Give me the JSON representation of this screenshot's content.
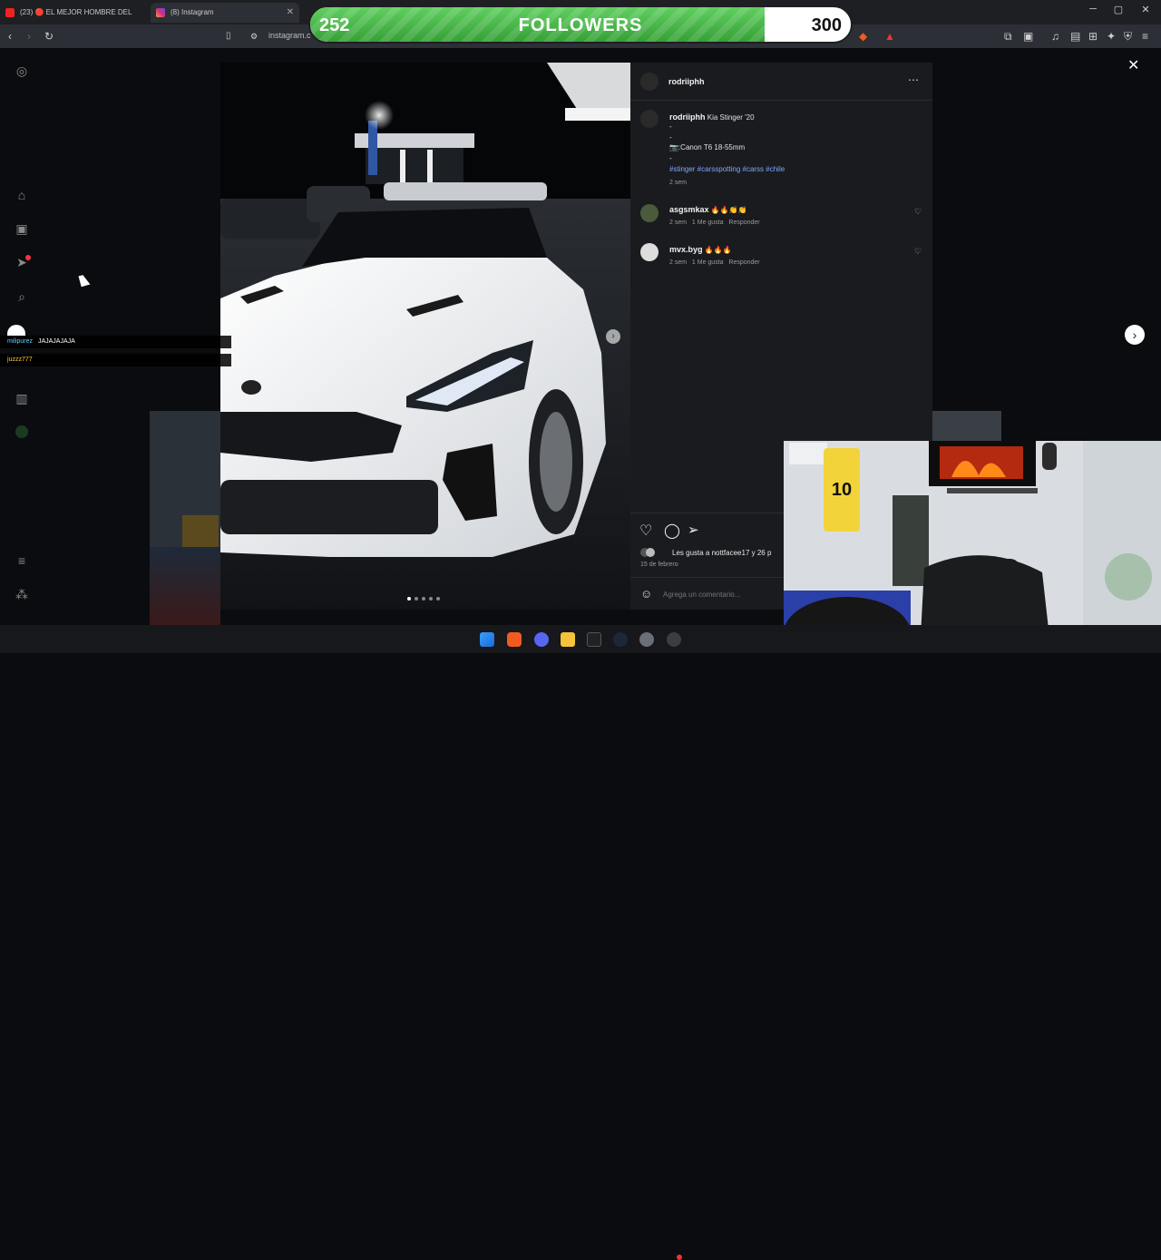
{
  "browser": {
    "tabs": [
      {
        "label": "(23) 🔴 EL MEJOR HOMBRE DEL"
      },
      {
        "label": "(8) Instagram"
      }
    ],
    "url": "instagram.c"
  },
  "followers_overlay": {
    "current": "252",
    "label": "FOLLOWERS",
    "goal": "300",
    "progress": 0.84
  },
  "chat_overlay": {
    "rows": [
      {
        "user": "milipurez",
        "msg": "JAJAJAJAJA"
      },
      {
        "user": "juzzz777",
        "msg": ""
      }
    ]
  },
  "post": {
    "author": "rodriiphh",
    "caption_author": "rodriiphh",
    "caption_title": "Kia Stinger '20",
    "caption_line1": "-",
    "caption_line2": "-",
    "caption_camera": "📷:Canon T6 18-55mm",
    "caption_line3": "-",
    "hashtags": "#stinger #carsspotting #carss #chile",
    "caption_time": "2 sem",
    "comments": [
      {
        "user": "asgsmkax",
        "text": "🔥🔥👏👏",
        "time": "2 sem",
        "likes": "1 Me gusta",
        "reply": "Responder"
      },
      {
        "user": "mvx.byg",
        "text": "🔥🔥🔥",
        "time": "2 sem",
        "likes": "1 Me gusta",
        "reply": "Responder"
      }
    ],
    "liked_by": "Les gusta a nottfacee17 y 26 p",
    "date": "15 de febrero",
    "add_comment_placeholder": "Agrega un comentario..."
  },
  "colors": {
    "accent_green": "#36a036",
    "panel_bg": "#1a1b1f",
    "hashtag": "#7fa8ff"
  }
}
